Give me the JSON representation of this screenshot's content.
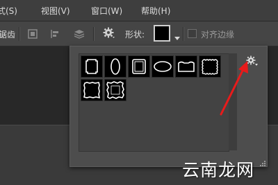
{
  "menubar": {
    "items": [
      {
        "label": "式(S)"
      },
      {
        "label": "视图(V)"
      },
      {
        "label": "窗口(W)"
      },
      {
        "label": "帮助(H)"
      }
    ]
  },
  "options_bar": {
    "left_label": "锯齿",
    "shape_label": "形状:",
    "align_edges_label": "对齐边缘",
    "align_edges_checked": false
  },
  "shape_picker": {
    "shapes": [
      {
        "icon": "frame-rect-notched-icon"
      },
      {
        "icon": "frame-oval-vertical-icon"
      },
      {
        "icon": "frame-rect-rounded-icon"
      },
      {
        "icon": "frame-oval-horizontal-icon"
      },
      {
        "icon": "frame-rect-scalloped-icon"
      },
      {
        "icon": "frame-rect-wavy-icon"
      },
      {
        "icon": "frame-rect-rough-filled-icon"
      },
      {
        "icon": "frame-rect-rough-outline-icon"
      }
    ]
  },
  "annotation": {
    "arrow_color": "#e81b1b"
  },
  "watermark": {
    "text": "云南龙网"
  },
  "colors": {
    "accent_red": "#e81b1b"
  }
}
